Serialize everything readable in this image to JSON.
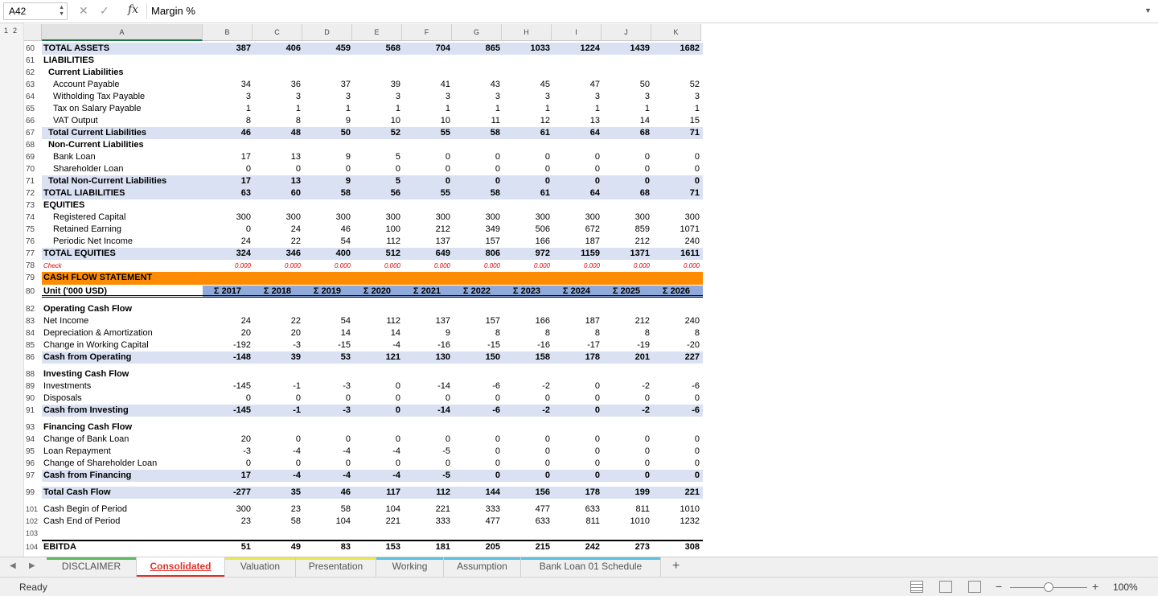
{
  "formula_bar": {
    "name_box": "A42",
    "fx": "fx",
    "formula": "Margin %"
  },
  "outline_levels": [
    "1",
    "2"
  ],
  "columns": [
    "A",
    "B",
    "C",
    "D",
    "E",
    "F",
    "G",
    "H",
    "I",
    "J",
    "K"
  ],
  "rows": [
    {
      "n": "60",
      "label": "TOTAL ASSETS",
      "style": "total",
      "values": [
        "387",
        "406",
        "459",
        "568",
        "704",
        "865",
        "1033",
        "1224",
        "1439",
        "1682"
      ]
    },
    {
      "n": "61",
      "label": "LIABILITIES",
      "style": "section",
      "values": []
    },
    {
      "n": "62",
      "label": "Current Liabilities",
      "style": "sub",
      "values": []
    },
    {
      "n": "63",
      "label": "Account Payable",
      "style": "item2",
      "values": [
        "34",
        "36",
        "37",
        "39",
        "41",
        "43",
        "45",
        "47",
        "50",
        "52"
      ]
    },
    {
      "n": "64",
      "label": "Witholding Tax Payable",
      "style": "item2",
      "values": [
        "3",
        "3",
        "3",
        "3",
        "3",
        "3",
        "3",
        "3",
        "3",
        "3"
      ]
    },
    {
      "n": "65",
      "label": "Tax on Salary Payable",
      "style": "item2",
      "values": [
        "1",
        "1",
        "1",
        "1",
        "1",
        "1",
        "1",
        "1",
        "1",
        "1"
      ]
    },
    {
      "n": "66",
      "label": "VAT Output",
      "style": "item2",
      "values": [
        "8",
        "8",
        "9",
        "10",
        "10",
        "11",
        "12",
        "13",
        "14",
        "15"
      ]
    },
    {
      "n": "67",
      "label": "Total Current Liabilities",
      "style": "subtotal",
      "values": [
        "46",
        "48",
        "50",
        "52",
        "55",
        "58",
        "61",
        "64",
        "68",
        "71"
      ]
    },
    {
      "n": "68",
      "label": "Non-Current Liabilities",
      "style": "sub",
      "values": []
    },
    {
      "n": "69",
      "label": "Bank Loan",
      "style": "item2",
      "values": [
        "17",
        "13",
        "9",
        "5",
        "0",
        "0",
        "0",
        "0",
        "0",
        "0"
      ]
    },
    {
      "n": "70",
      "label": "Shareholder Loan",
      "style": "item2",
      "values": [
        "0",
        "0",
        "0",
        "0",
        "0",
        "0",
        "0",
        "0",
        "0",
        "0"
      ]
    },
    {
      "n": "71",
      "label": "Total Non-Current Liabilities",
      "style": "subtotal",
      "values": [
        "17",
        "13",
        "9",
        "5",
        "0",
        "0",
        "0",
        "0",
        "0",
        "0"
      ]
    },
    {
      "n": "72",
      "label": "TOTAL LIABILITIES",
      "style": "total",
      "values": [
        "63",
        "60",
        "58",
        "56",
        "55",
        "58",
        "61",
        "64",
        "68",
        "71"
      ]
    },
    {
      "n": "73",
      "label": "EQUITIES",
      "style": "section",
      "values": []
    },
    {
      "n": "74",
      "label": "Registered Capital",
      "style": "item2",
      "values": [
        "300",
        "300",
        "300",
        "300",
        "300",
        "300",
        "300",
        "300",
        "300",
        "300"
      ]
    },
    {
      "n": "75",
      "label": "Retained Earning",
      "style": "item2",
      "values": [
        "0",
        "24",
        "46",
        "100",
        "212",
        "349",
        "506",
        "672",
        "859",
        "1071"
      ]
    },
    {
      "n": "76",
      "label": "Periodic Net Income",
      "style": "item2",
      "values": [
        "24",
        "22",
        "54",
        "112",
        "137",
        "157",
        "166",
        "187",
        "212",
        "240"
      ]
    },
    {
      "n": "77",
      "label": "TOTAL EQUITIES",
      "style": "total",
      "values": [
        "324",
        "346",
        "400",
        "512",
        "649",
        "806",
        "972",
        "1159",
        "1371",
        "1611"
      ]
    },
    {
      "n": "78",
      "label": "Check",
      "style": "check",
      "values": [
        "0.000",
        "0.000",
        "0.000",
        "0.000",
        "0.000",
        "0.000",
        "0.000",
        "0.000",
        "0.000",
        "0.000"
      ]
    },
    {
      "n": "79",
      "label": "CASH FLOW STATEMENT",
      "style": "banner",
      "values": []
    },
    {
      "n": "80",
      "label": "Unit ('000 USD)",
      "style": "header",
      "values": [
        "Σ 2017",
        "Σ 2018",
        "Σ 2019",
        "Σ 2020",
        "Σ 2021",
        "Σ 2022",
        "Σ 2023",
        "Σ 2024",
        "Σ 2025",
        "Σ 2026"
      ]
    },
    {
      "n": "82",
      "label": "Operating Cash Flow",
      "style": "section",
      "values": []
    },
    {
      "n": "83",
      "label": "Net Income",
      "style": "item",
      "values": [
        "24",
        "22",
        "54",
        "112",
        "137",
        "157",
        "166",
        "187",
        "212",
        "240"
      ]
    },
    {
      "n": "84",
      "label": "Depreciation & Amortization",
      "style": "item",
      "values": [
        "20",
        "20",
        "14",
        "14",
        "9",
        "8",
        "8",
        "8",
        "8",
        "8"
      ]
    },
    {
      "n": "85",
      "label": "Change in Working Capital",
      "style": "item",
      "values": [
        "-192",
        "-3",
        "-15",
        "-4",
        "-16",
        "-15",
        "-16",
        "-17",
        "-19",
        "-20"
      ]
    },
    {
      "n": "86",
      "label": "Cash from Operating",
      "style": "total",
      "values": [
        "-148",
        "39",
        "53",
        "121",
        "130",
        "150",
        "158",
        "178",
        "201",
        "227"
      ]
    },
    {
      "n": "88",
      "label": "Investing Cash Flow",
      "style": "section",
      "values": []
    },
    {
      "n": "89",
      "label": "Investments",
      "style": "item",
      "values": [
        "-145",
        "-1",
        "-3",
        "0",
        "-14",
        "-6",
        "-2",
        "0",
        "-2",
        "-6"
      ]
    },
    {
      "n": "90",
      "label": "Disposals",
      "style": "item",
      "values": [
        "0",
        "0",
        "0",
        "0",
        "0",
        "0",
        "0",
        "0",
        "0",
        "0"
      ]
    },
    {
      "n": "91",
      "label": "Cash from Investing",
      "style": "total",
      "values": [
        "-145",
        "-1",
        "-3",
        "0",
        "-14",
        "-6",
        "-2",
        "0",
        "-2",
        "-6"
      ]
    },
    {
      "n": "93",
      "label": "Financing Cash Flow",
      "style": "section",
      "values": []
    },
    {
      "n": "94",
      "label": "Change of Bank Loan",
      "style": "item",
      "values": [
        "20",
        "0",
        "0",
        "0",
        "0",
        "0",
        "0",
        "0",
        "0",
        "0"
      ]
    },
    {
      "n": "95",
      "label": "Loan Repayment",
      "style": "item",
      "values": [
        "-3",
        "-4",
        "-4",
        "-4",
        "-5",
        "0",
        "0",
        "0",
        "0",
        "0"
      ]
    },
    {
      "n": "96",
      "label": "Change of Shareholder Loan",
      "style": "item",
      "values": [
        "0",
        "0",
        "0",
        "0",
        "0",
        "0",
        "0",
        "0",
        "0",
        "0"
      ]
    },
    {
      "n": "97",
      "label": "Cash from Financing",
      "style": "total",
      "values": [
        "17",
        "-4",
        "-4",
        "-4",
        "-5",
        "0",
        "0",
        "0",
        "0",
        "0"
      ]
    },
    {
      "n": "99",
      "label": "Total Cash Flow",
      "style": "total",
      "values": [
        "-277",
        "35",
        "46",
        "117",
        "112",
        "144",
        "156",
        "178",
        "199",
        "221"
      ]
    },
    {
      "n": "101",
      "label": "Cash Begin of Period",
      "style": "item",
      "values": [
        "300",
        "23",
        "58",
        "104",
        "221",
        "333",
        "477",
        "633",
        "811",
        "1010"
      ]
    },
    {
      "n": "102",
      "label": "Cash End of Period",
      "style": "item",
      "values": [
        "23",
        "58",
        "104",
        "221",
        "333",
        "477",
        "633",
        "811",
        "1010",
        "1232"
      ]
    },
    {
      "n": "103",
      "label": "",
      "style": "blank",
      "values": []
    },
    {
      "n": "104",
      "label": "EBITDA",
      "style": "ebitda",
      "values": [
        "51",
        "49",
        "83",
        "153",
        "181",
        "205",
        "215",
        "242",
        "273",
        "308"
      ]
    }
  ],
  "sheets": [
    {
      "name": "DISCLAIMER",
      "active": false,
      "color": "#5cb85c"
    },
    {
      "name": "Consolidated",
      "active": true,
      "color": "#e0302c"
    },
    {
      "name": "Valuation",
      "active": false,
      "color": "#e8e84a"
    },
    {
      "name": "Presentation",
      "active": false,
      "color": "#e8e84a"
    },
    {
      "name": "Working",
      "active": false,
      "color": "#5bc0de"
    },
    {
      "name": "Assumption",
      "active": false,
      "color": "#5bc0de"
    },
    {
      "name": "Bank Loan 01 Schedule",
      "active": false,
      "color": "#5bc0de"
    }
  ],
  "status": {
    "ready": "Ready",
    "zoom": "100%"
  },
  "colors": {
    "total_fill": "#d9e1f2",
    "banner_fill": "#ff8c00",
    "header_fill": "#8ea9db",
    "check_red": "#e00000",
    "active_tab": "#e0302c"
  }
}
